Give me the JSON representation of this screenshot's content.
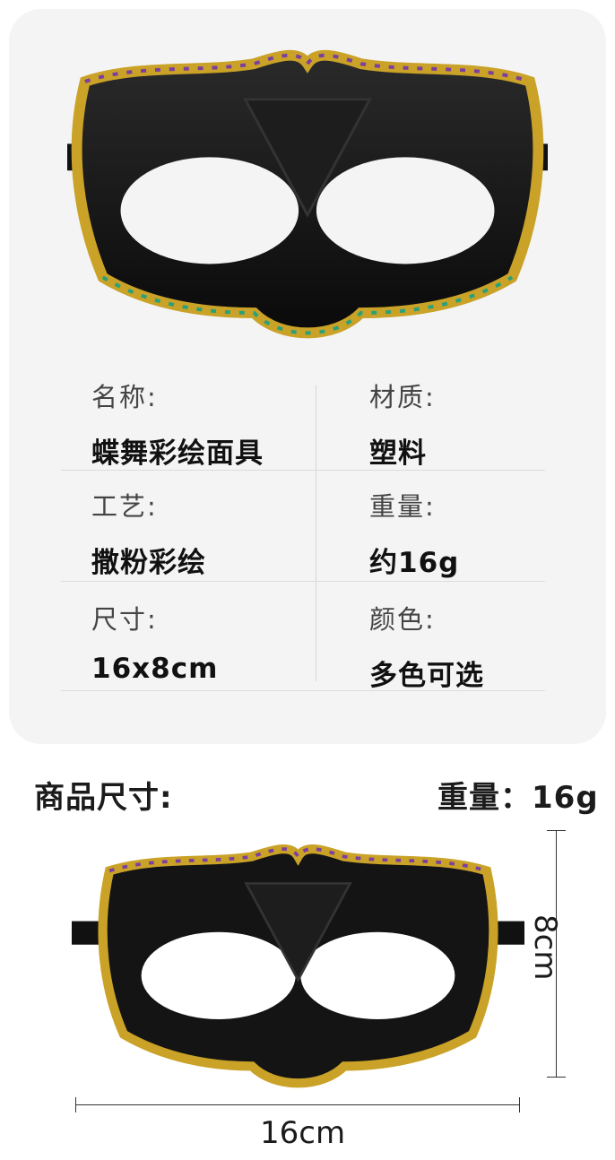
{
  "specs": {
    "name_label": "名称:",
    "name_value": "蝶舞彩绘面具",
    "material_label": "材质:",
    "material_value": "塑料",
    "craft_label": "工艺:",
    "craft_value": "撒粉彩绘",
    "weight_label": "重量:",
    "weight_value": "约16g",
    "size_label": "尺寸:",
    "size_value": "16x8cm",
    "color_label": "颜色:",
    "color_value": "多色可选"
  },
  "dimensions": {
    "title": "商品尺寸:",
    "weight_text": "重量：16g",
    "width_label": "16cm",
    "height_label": "8cm"
  },
  "colors": {
    "card_bg": "#f4f4f4",
    "mask_black": "#141414",
    "trim_gold": "#c9a227"
  }
}
